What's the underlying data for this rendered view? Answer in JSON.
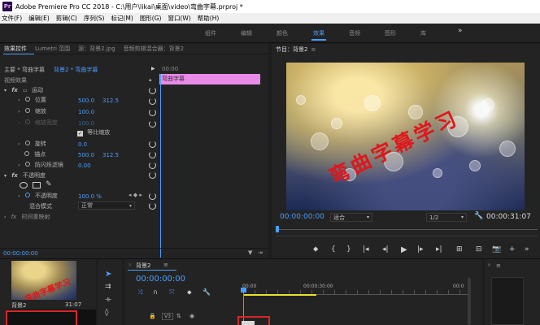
{
  "window": {
    "title": "Adobe Premiere Pro CC 2018 - C:\\用户\\likai\\桌面\\video\\弯曲字幕.prproj *",
    "logo_text": "Pr"
  },
  "menu": [
    "文件(F)",
    "编辑(E)",
    "剪辑(C)",
    "序列(S)",
    "标记(M)",
    "图形(G)",
    "窗口(W)",
    "帮助(H)"
  ],
  "workspaces": [
    {
      "label": "组件",
      "active": false
    },
    {
      "label": "编辑",
      "active": false
    },
    {
      "label": "颜色",
      "active": false
    },
    {
      "label": "效果",
      "active": true
    },
    {
      "label": "音频",
      "active": false
    },
    {
      "label": "图形",
      "active": false
    },
    {
      "label": "库",
      "active": false
    }
  ],
  "workspace_more": "»",
  "effect_controls": {
    "tabs": [
      "效果控件",
      "Lumetri 范围",
      "源：背景2.jpg",
      "音频剪辑混合器：背景2"
    ],
    "source_label": "主要 * 弯曲字幕",
    "clip_label": "背景2 * 弯曲字幕",
    "clip_bar_label": "弯曲字幕",
    "timecode_start": "00:00",
    "section_video": "视频效果",
    "motion": "运动",
    "position_label": "位置",
    "position_x": "500.0",
    "position_y": "312.5",
    "scale_label": "缩放",
    "scale_val": "100.0",
    "scale_width_label": "缩放宽度",
    "scale_width_val": "100.0",
    "uniform_scale": "等比缩放",
    "rotation_label": "旋转",
    "rotation_val": "0.0",
    "anchor_label": "锚点",
    "anchor_x": "500.0",
    "anchor_y": "312.5",
    "flicker_label": "防闪烁滤镜",
    "flicker_val": "0.00",
    "opacity": "不透明度",
    "opacity_label": "不透明度",
    "opacity_val": "100.0 %",
    "blend_label": "混合模式",
    "blend_val": "正常",
    "time_remap": "时间重映射",
    "bottom_timecode": "00:00:00:00"
  },
  "program": {
    "tab": "节目：背景2",
    "subtitle": "弯曲字幕学习",
    "timecode": "00:00:00:00",
    "fit": "适合",
    "quality": "1/2",
    "duration": "00:00:31:07"
  },
  "project": {
    "thumb_title": "背景2",
    "thumb_duration": "31:07",
    "thumb_subtitle": "弯曲字幕学习"
  },
  "timeline": {
    "tab": "背景2",
    "timecode": "00:00:00:00",
    "ruler": [
      "00:00",
      "00:00:30:00",
      "00:0"
    ],
    "track": "V3"
  },
  "colors": {
    "accent": "#4a9eff",
    "clip": "#e88ae8",
    "red": "#d7262a",
    "playhead": "#4a9eff"
  }
}
